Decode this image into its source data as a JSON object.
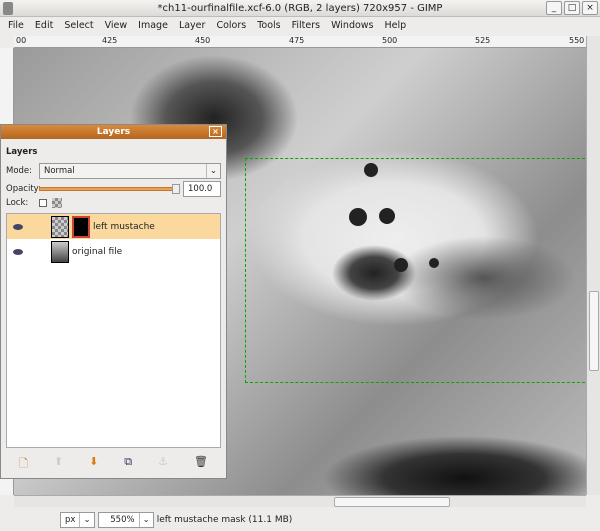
{
  "window": {
    "title": "*ch11-ourfinalfile.xcf-6.0 (RGB, 2 layers) 720x957 - GIMP",
    "minimize": "_",
    "maximize": "□",
    "close": "×"
  },
  "menu": [
    "File",
    "Edit",
    "Select",
    "View",
    "Image",
    "Layer",
    "Colors",
    "Tools",
    "Filters",
    "Windows",
    "Help"
  ],
  "ruler": {
    "labels": [
      "00",
      "425",
      "450",
      "475",
      "500",
      "525",
      "550"
    ]
  },
  "status": {
    "unit": "px",
    "zoom": "550%",
    "message": "left mustache mask (11.1 MB)"
  },
  "layers_dialog": {
    "title": "Layers",
    "heading": "Layers",
    "mode_label": "Mode:",
    "mode_value": "Normal",
    "opacity_label": "Opacity:",
    "opacity_value": "100.0",
    "opacity_percent": 100,
    "lock_label": "Lock:",
    "layers": [
      {
        "name": "left mustache",
        "selected": true,
        "visible": true
      },
      {
        "name": "original file",
        "selected": false,
        "visible": true
      }
    ],
    "buttons": [
      "new-layer",
      "raise-layer",
      "lower-layer",
      "duplicate-layer",
      "anchor-layer",
      "delete-layer"
    ]
  },
  "colors": {
    "accent": "#c8772a",
    "selection": "#fbd89e"
  }
}
